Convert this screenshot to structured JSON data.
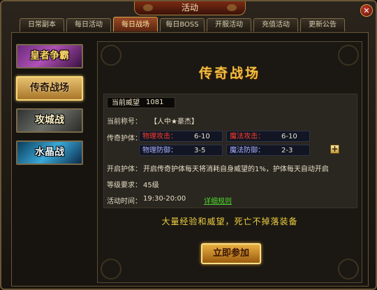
{
  "window": {
    "title": "活动",
    "close_icon": "close-icon"
  },
  "tabs": [
    {
      "label": "日常副本"
    },
    {
      "label": "每日活动"
    },
    {
      "label": "每日战场",
      "active": true
    },
    {
      "label": "每日BOSS"
    },
    {
      "label": "开服活动"
    },
    {
      "label": "充值活动"
    },
    {
      "label": "更新公告"
    }
  ],
  "sidebar": {
    "items": [
      {
        "label": "皇者争霸"
      },
      {
        "label": "传奇战场",
        "selected": true
      },
      {
        "label": "攻城战"
      },
      {
        "label": "水晶战"
      }
    ]
  },
  "panel": {
    "title": "传奇战场",
    "prestige_label": "当前威望",
    "prestige_value": "1081",
    "title_label": "当前称号：",
    "title_value": "【人中★豪杰】",
    "guard_label": "传奇护体：",
    "attrs": {
      "phys_atk_name": "物理攻击：",
      "phys_atk_value": "6-10",
      "magic_atk_name": "魔法攻击：",
      "magic_atk_value": "6-10",
      "phys_def_name": "物理防御：",
      "phys_def_value": "3-5",
      "magic_def_name": "魔法防御：",
      "magic_def_value": "2-3"
    },
    "enable_label": "开启护体：",
    "enable_desc": "开启传奇护体每天将消耗自身威望的1%，护体每天自动开启",
    "level_label": "等级要求：",
    "level_value": "45级",
    "time_label": "活动时间：",
    "time_value": "19:30-20:00",
    "rules_link": "详细规则",
    "slogan": "大量经验和威望，死亡不掉落装备",
    "join_button": "立即参加"
  },
  "colors": {
    "accent_gold": "#f0c040",
    "attack_red": "#ff3c2a",
    "link_green": "#4cd82a"
  }
}
